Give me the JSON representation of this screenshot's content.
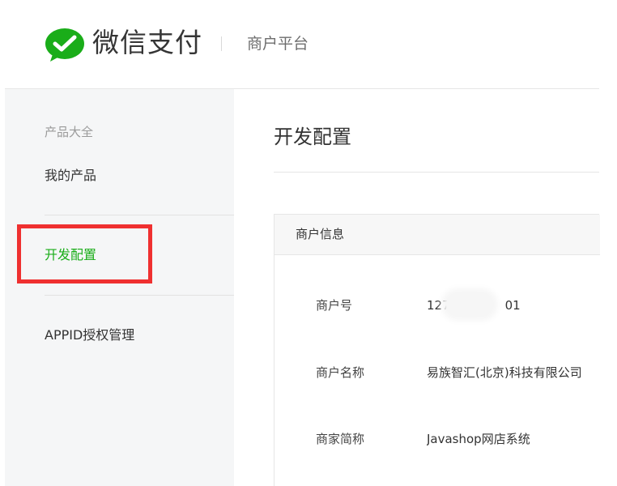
{
  "header": {
    "logo_text": "微信支付",
    "subtitle": "商户平台",
    "logo_icon": "wechat-pay-icon",
    "brand_color": "#1aad19"
  },
  "sidebar": {
    "category": "产品大全",
    "items": [
      {
        "label": "我的产品",
        "active": false
      },
      {
        "label": "开发配置",
        "active": true
      },
      {
        "label": "APPID授权管理",
        "active": false
      }
    ],
    "active_color": "#1aad19",
    "annotation_color": "#ef3030"
  },
  "main": {
    "title": "开发配置",
    "panel": {
      "heading": "商户信息",
      "rows": [
        {
          "label": "商户号",
          "value_start": "127",
          "value_end": "01"
        },
        {
          "label": "商户名称",
          "value": "易族智汇(北京)科技有限公司"
        },
        {
          "label": "商家简称",
          "value": "Javashop网店系统"
        }
      ]
    }
  }
}
